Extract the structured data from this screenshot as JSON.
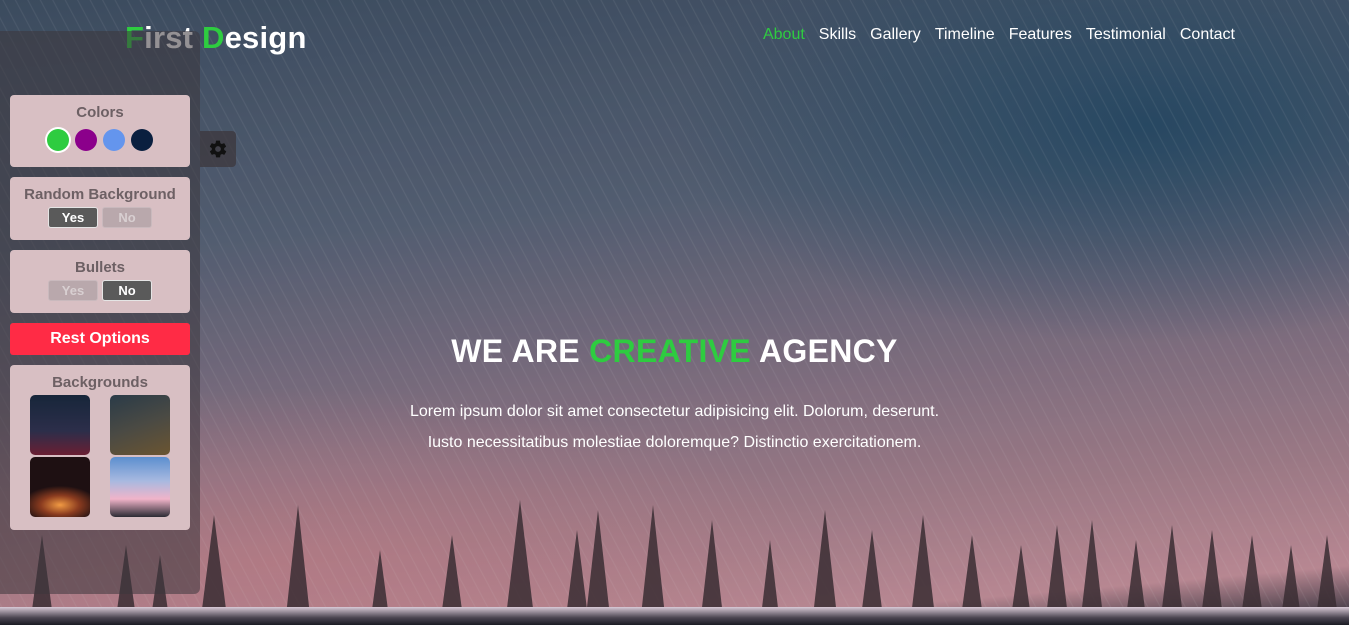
{
  "header": {
    "logo": {
      "first_letter": "F",
      "first_rest": "irst",
      "second_letter": "D",
      "second_rest": "esign"
    },
    "nav": [
      {
        "label": "About",
        "active": true
      },
      {
        "label": "Skills",
        "active": false
      },
      {
        "label": "Gallery",
        "active": false
      },
      {
        "label": "Timeline",
        "active": false
      },
      {
        "label": "Features",
        "active": false
      },
      {
        "label": "Testimonial",
        "active": false
      },
      {
        "label": "Contact",
        "active": false
      }
    ]
  },
  "hero": {
    "headline_pre": "WE ARE",
    "headline_accent": "CREATIVE",
    "headline_post": "AGENCY",
    "lead_line1": "Lorem ipsum dolor sit amet consectetur adipisicing elit. Dolorum, deserunt.",
    "lead_line2": "Iusto necessitatibus molestiae doloremque? Distinctio exercitationem."
  },
  "settings": {
    "toggle_icon": "gear-icon",
    "colors": {
      "title": "Colors",
      "options": [
        "#2ecc40",
        "#8b008b",
        "#6495ed",
        "#0a1f3f"
      ],
      "selected": "#2ecc40"
    },
    "random_background": {
      "title": "Random Background",
      "yes": "Yes",
      "no": "No",
      "selected": "Yes"
    },
    "bullets": {
      "title": "Bullets",
      "yes": "Yes",
      "no": "No",
      "selected": "No"
    },
    "reset_label": "Rest Options",
    "backgrounds": {
      "title": "Backgrounds",
      "count": 4
    }
  },
  "theme": {
    "accent": "#2ecc40",
    "reset": "#ff2b45"
  }
}
